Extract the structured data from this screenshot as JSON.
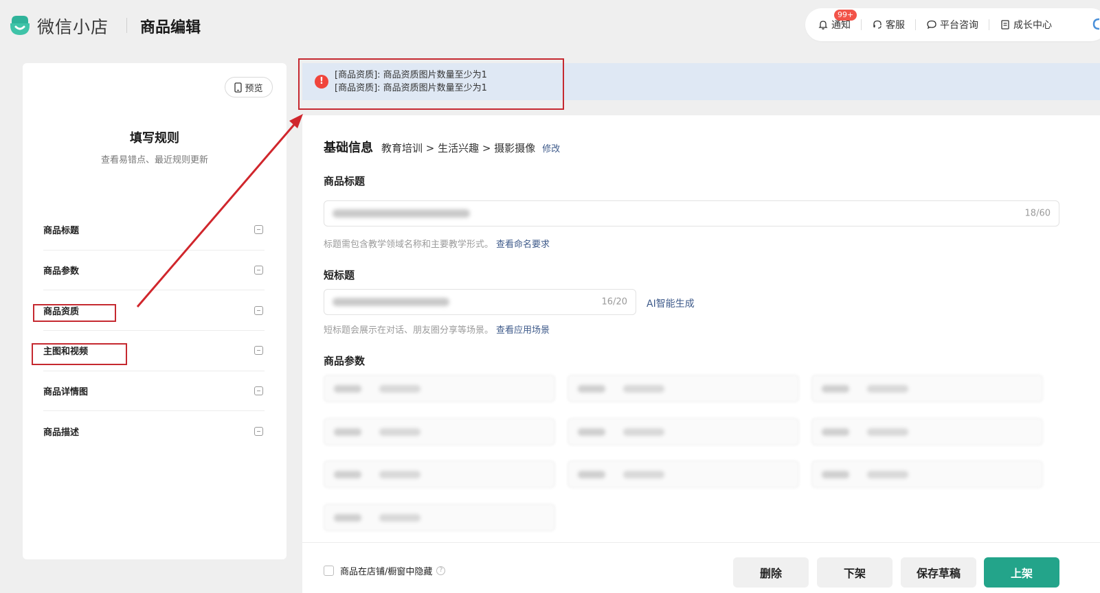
{
  "header": {
    "logo_text": "微信小店",
    "page_title": "商品编辑",
    "actions": [
      {
        "label": "通知",
        "icon": "bell-icon",
        "badge": "99+"
      },
      {
        "label": "客服",
        "icon": "headset-icon"
      },
      {
        "label": "平台咨询",
        "icon": "chat-bubble-icon"
      },
      {
        "label": "成长中心",
        "icon": "document-icon"
      }
    ]
  },
  "sidebar": {
    "preview_label": "预览",
    "rules_title": "填写规则",
    "rules_subtitle": "查看易错点、最近规则更新",
    "items": [
      {
        "label": "商品标题"
      },
      {
        "label": "商品参数"
      },
      {
        "label": "商品资质"
      },
      {
        "label": "主图和视频"
      },
      {
        "label": "商品详情图"
      },
      {
        "label": "商品描述"
      }
    ]
  },
  "error_banner": {
    "messages": [
      "[商品资质]: 商品资质图片数量至少为1",
      "[商品资质]: 商品资质图片数量至少为1"
    ]
  },
  "basic_info": {
    "title": "基础信息",
    "category_path": "教育培训 > 生活兴趣 > 摄影摄像",
    "modify_label": "修改"
  },
  "product_title": {
    "label": "商品标题",
    "counter": "18/60",
    "hint": "标题需包含教学领域名称和主要教学形式。",
    "hint_link": "查看命名要求"
  },
  "short_title": {
    "label": "短标题",
    "counter": "16/20",
    "ai_label": "AI智能生成",
    "hint": "短标题会展示在对话、朋友圈分享等场景。",
    "hint_link": "查看应用场景"
  },
  "params": {
    "label": "商品参数"
  },
  "footer": {
    "hide_label": "商品在店铺/橱窗中隐藏",
    "help_icon": "?",
    "buttons": {
      "delete": "删除",
      "unlist": "下架",
      "save_draft": "保存草稿",
      "publish": "上架"
    }
  },
  "colors": {
    "primary": "#23a48a",
    "error": "#f0453c",
    "annotation": "#c5282f",
    "link": "#3e5a8a",
    "banner_bg": "#dfe8f4"
  }
}
